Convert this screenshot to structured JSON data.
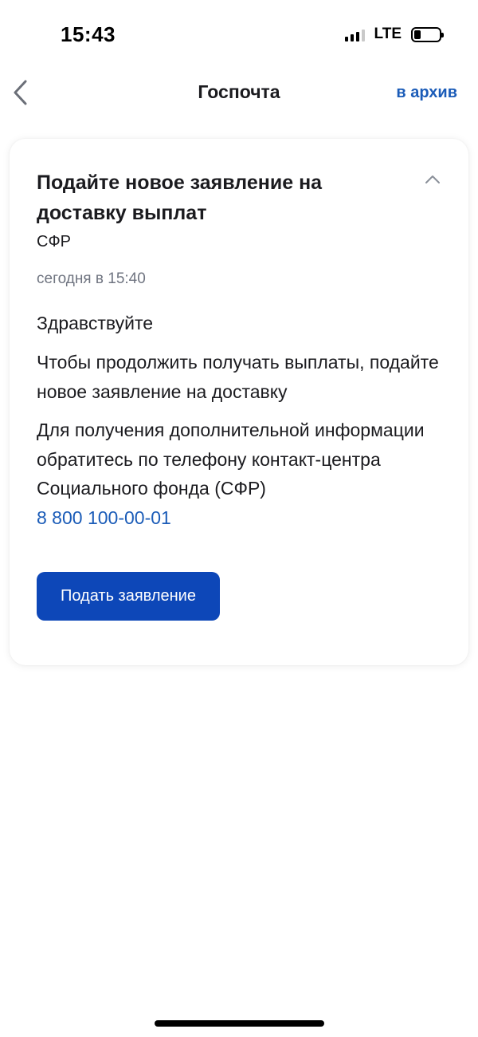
{
  "status_bar": {
    "time": "15:43",
    "network": "LTE",
    "icons": [
      "signal-icon",
      "battery-icon"
    ]
  },
  "nav": {
    "back_icon": "chevron-left-icon",
    "title": "Госпочта",
    "archive_label": "в архив"
  },
  "message": {
    "title": "Подайте новое заявление на доставку выплат",
    "collapse_icon": "chevron-up-icon",
    "sender": "СФР",
    "timestamp": "сегодня в 15:40",
    "greeting": "Здравствуйте",
    "paragraph1": "Чтобы продолжить получать выплаты, подайте новое заявление на доставку",
    "paragraph2": "Для получения дополнительной информации обратитесь по телефону контакт-центра Социального фонда (СФР)",
    "phone": "8 800 100-00-01",
    "button_label": "Подать заявление"
  },
  "colors": {
    "accent": "#1b5cb8",
    "button": "#0d47b8",
    "secondary_text": "#6f7480"
  }
}
